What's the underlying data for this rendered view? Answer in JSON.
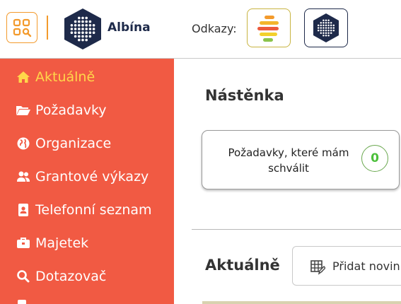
{
  "app": {
    "name": "Albína"
  },
  "header": {
    "links_label": "Odkazy:"
  },
  "sidebar": {
    "items": [
      {
        "label": "Aktuálně",
        "icon": "home-icon",
        "active": true
      },
      {
        "label": "Požadavky",
        "icon": "folder-open-icon"
      },
      {
        "label": "Organizace",
        "icon": "globe-icon"
      },
      {
        "label": "Grantové výkazy",
        "icon": "users-icon"
      },
      {
        "label": "Telefonní seznam",
        "icon": "address-card-icon"
      },
      {
        "label": "Majetek",
        "icon": "toolbox-icon"
      },
      {
        "label": "Dotazovač",
        "icon": "search-icon"
      }
    ]
  },
  "main": {
    "dashboard_title": "Nástěnka",
    "card": {
      "label": "Požadavky, které mám schválit",
      "count": "0"
    },
    "news_title": "Aktuálně",
    "add_news_label": "Přidat novinku"
  },
  "colors": {
    "sidebar_bg": "#f15a43",
    "sidebar_active": "#ffd64a",
    "accent_orange": "#f39a2c",
    "logo_navy": "#1e2a4a",
    "count_green": "#4bbf3a"
  }
}
